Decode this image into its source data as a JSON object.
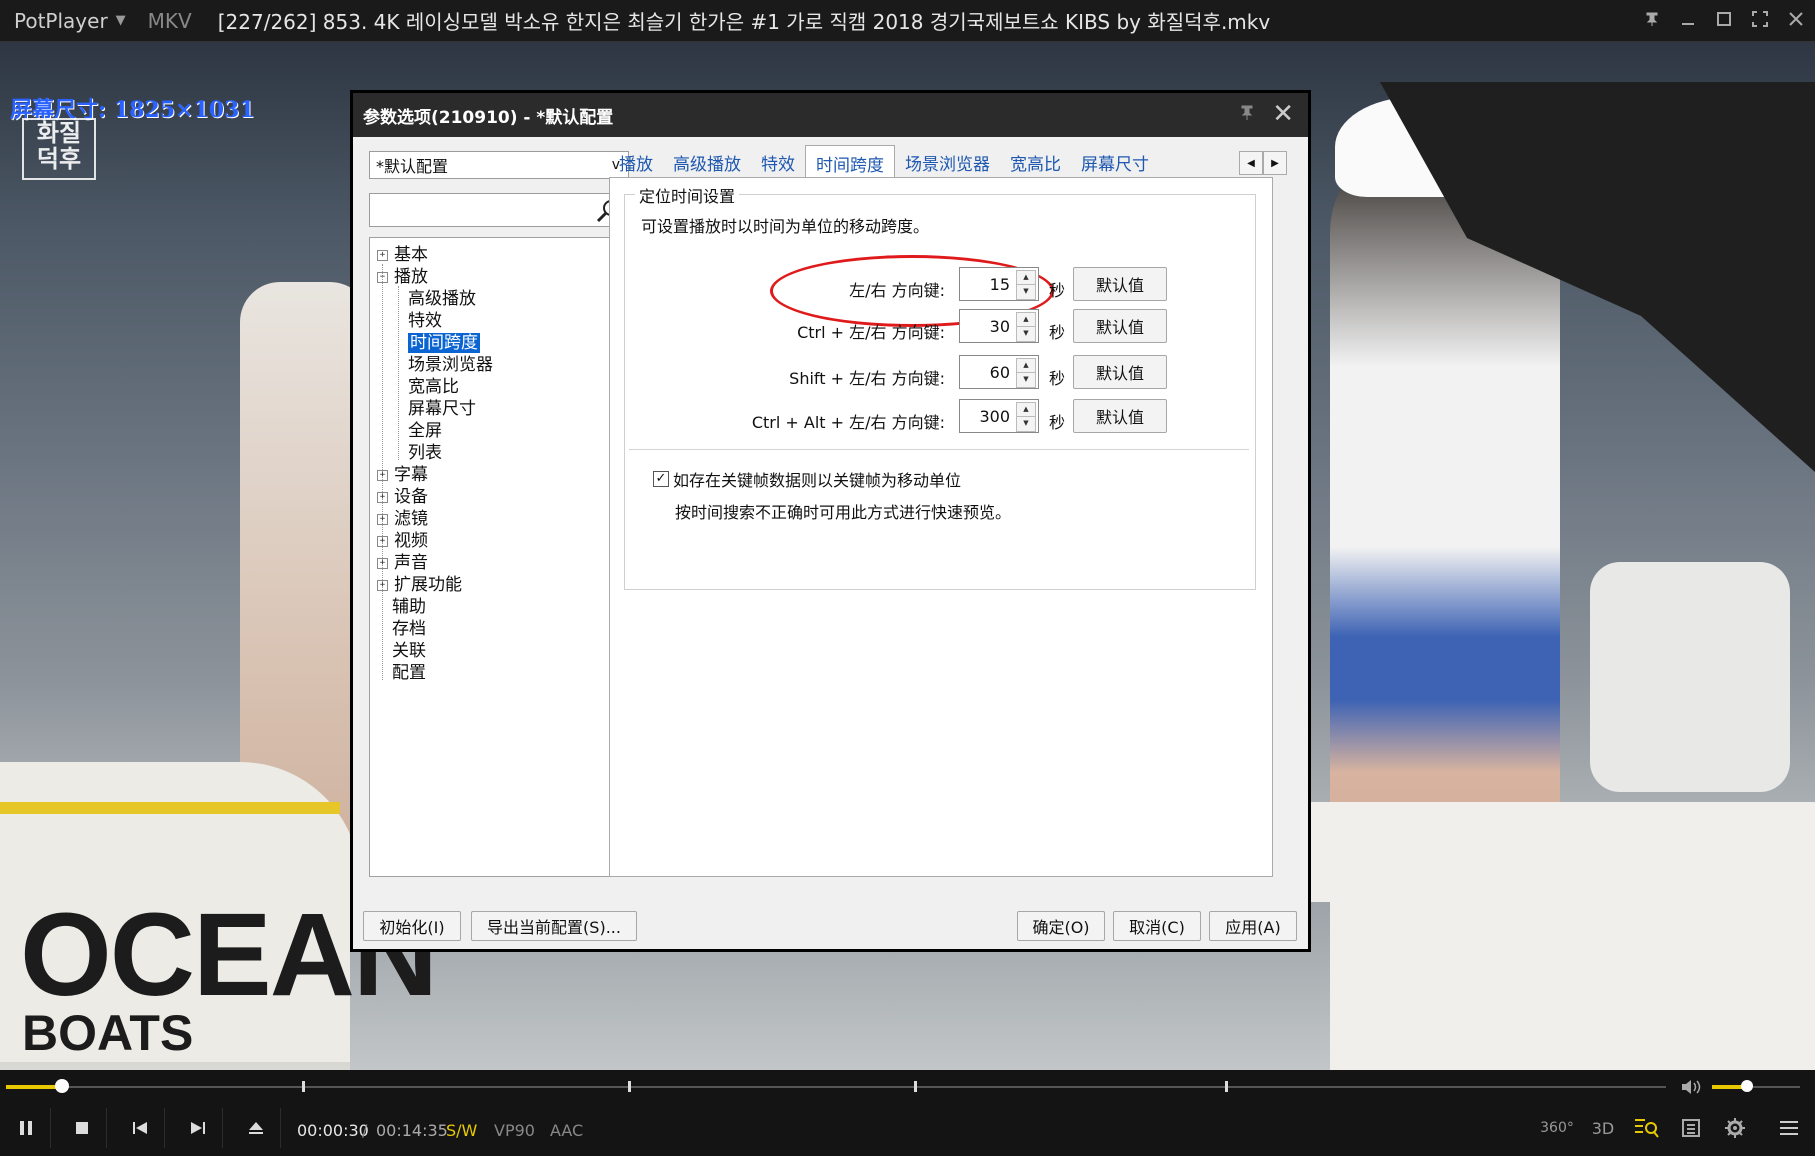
{
  "titlebar": {
    "app_name": "PotPlayer",
    "format": "MKV",
    "title": "[227/262] 853. 4K 레이싱모델 박소유 한지은 최슬기 한가은 #1 가로 직캠 2018 경기국제보트쇼 KIBS by 화질덕후.mkv"
  },
  "video": {
    "osd_size": "屏幕尺寸: 1825×1031",
    "watermark_line1": "화질",
    "watermark_line2": "덕후",
    "ocean": "OCEAN",
    "boats": "BOATS"
  },
  "dialog": {
    "title": "参数选项(210910) - *默认配置",
    "profile": "*默认配置",
    "tree": [
      {
        "label": "基本",
        "expander": "+"
      },
      {
        "label": "播放",
        "expander": "−"
      },
      {
        "label": "高级播放",
        "child": true
      },
      {
        "label": "特效",
        "child": true
      },
      {
        "label": "时间跨度",
        "child": true,
        "selected": true
      },
      {
        "label": "场景浏览器",
        "child": true
      },
      {
        "label": "宽高比",
        "child": true
      },
      {
        "label": "屏幕尺寸",
        "child": true
      },
      {
        "label": "全屏",
        "child": true
      },
      {
        "label": "列表",
        "child": true
      },
      {
        "label": "字幕",
        "expander": "+"
      },
      {
        "label": "设备",
        "expander": "+"
      },
      {
        "label": "滤镜",
        "expander": "+"
      },
      {
        "label": "视频",
        "expander": "+"
      },
      {
        "label": "声音",
        "expander": "+"
      },
      {
        "label": "扩展功能",
        "expander": "+"
      },
      {
        "label": "辅助"
      },
      {
        "label": "存档"
      },
      {
        "label": "关联"
      },
      {
        "label": "配置"
      }
    ],
    "tabs": [
      "播放",
      "高级播放",
      "特效",
      "时间跨度",
      "场景浏览器",
      "宽高比",
      "屏幕尺寸"
    ],
    "active_tab": "时间跨度",
    "group_title": "定位时间设置",
    "group_desc": "可设置播放时以时间为单位的移动跨度。",
    "rows": [
      {
        "label": "左/右 方向键:",
        "value": "15",
        "unit": "秒",
        "button": "默认值"
      },
      {
        "label": "Ctrl + 左/右 方向键:",
        "value": "30",
        "unit": "秒",
        "button": "默认值"
      },
      {
        "label": "Shift + 左/右 方向键:",
        "value": "60",
        "unit": "秒",
        "button": "默认值"
      },
      {
        "label": "Ctrl + Alt + 左/右 方向键:",
        "value": "300",
        "unit": "秒",
        "button": "默认值"
      }
    ],
    "keyframe_checked": true,
    "keyframe_label": "如存在关键帧数据则以关键帧为移动单位",
    "keyframe_note": "按时间搜索不正确时可用此方式进行快速预览。",
    "buttons": {
      "init": "初始化(I)",
      "export": "导出当前配置(S)...",
      "ok": "确定(O)",
      "cancel": "取消(C)",
      "apply": "应用(A)"
    }
  },
  "player": {
    "time_current": "00:00:30",
    "time_separator": "/",
    "time_total": "00:14:35",
    "progress": 0.034,
    "volume": 0.4,
    "badge_sw": "S/W",
    "badge_vcodec": "VP90",
    "badge_acodec": "AAC",
    "label_360": "360°",
    "label_3d": "3D",
    "accent": "#e8c800"
  }
}
